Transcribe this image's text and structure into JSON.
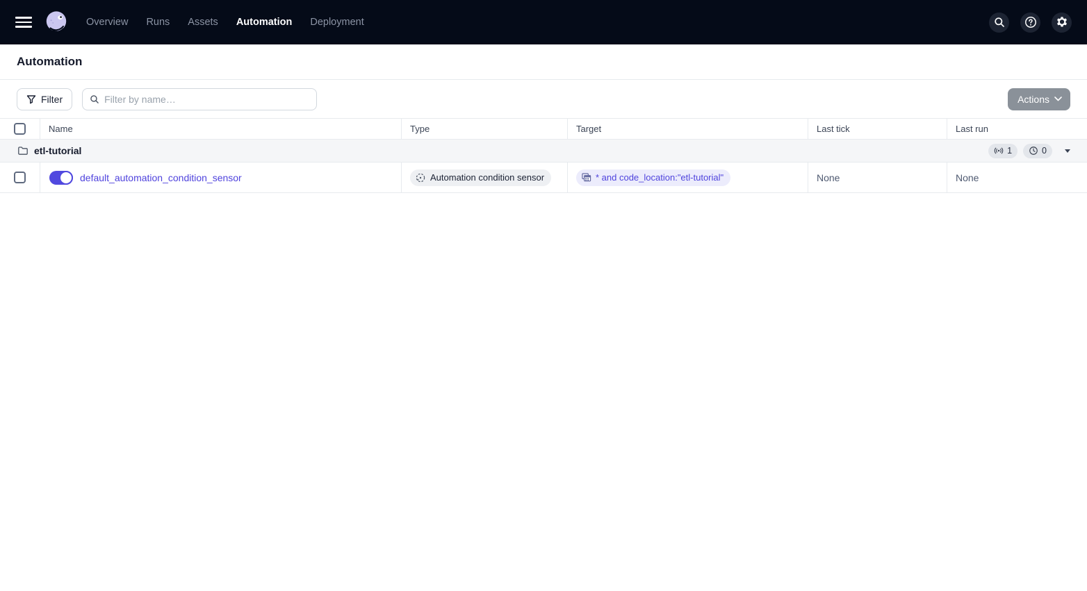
{
  "navbar": {
    "items": [
      {
        "label": "Overview",
        "active": false
      },
      {
        "label": "Runs",
        "active": false
      },
      {
        "label": "Assets",
        "active": false
      },
      {
        "label": "Automation",
        "active": true
      },
      {
        "label": "Deployment",
        "active": false
      }
    ],
    "icons": [
      "search-icon",
      "help-icon",
      "gear-icon"
    ]
  },
  "page": {
    "title": "Automation"
  },
  "toolbar": {
    "filter_label": "Filter",
    "search_placeholder": "Filter by name…",
    "search_value": "",
    "actions_label": "Actions"
  },
  "table": {
    "columns": [
      "Name",
      "Type",
      "Target",
      "Last tick",
      "Last run"
    ],
    "group": {
      "name": "etl-tutorial",
      "sensor_count": "1",
      "schedule_count": "0"
    },
    "rows": [
      {
        "enabled": true,
        "name": "default_automation_condition_sensor",
        "type": "Automation condition sensor",
        "target": "* and code_location:\"etl-tutorial\"",
        "last_tick": "None",
        "last_run": "None"
      }
    ]
  },
  "colors": {
    "navbar_bg": "#050b18",
    "accent_purple": "#4f43dd",
    "toggle_on": "#5149df",
    "disabled_button_bg": "#8a9199",
    "group_row_bg": "#f5f6f8",
    "target_pill_bg": "#ececfc",
    "type_pill_bg": "#eef0f3",
    "border": "#e7eaee"
  }
}
